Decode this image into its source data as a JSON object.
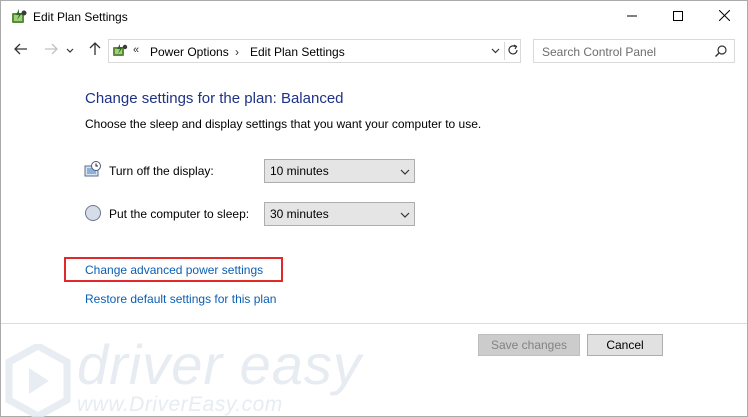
{
  "window": {
    "title": "Edit Plan Settings",
    "app_icon": "power-options-icon",
    "controls": [
      "minimize-icon",
      "maximize-icon",
      "close-icon"
    ]
  },
  "navigation": {
    "back_icon": "arrow-left-icon",
    "forward_icon": "arrow-right-icon",
    "recent_icon": "chevron-down-icon",
    "up_icon": "arrow-up-icon",
    "address": {
      "overflow": "«",
      "breadcrumbs": [
        "Power Options",
        "Edit Plan Settings"
      ],
      "separator": "›"
    },
    "search": {
      "placeholder": "Search Control Panel"
    }
  },
  "main": {
    "heading": "Change settings for the plan: Balanced",
    "description": "Choose the sleep and display settings that you want your computer to use.",
    "settings": [
      {
        "label": "Turn off the display:",
        "value": "10 minutes",
        "icon": "display-clock-icon"
      },
      {
        "label": "Put the computer to sleep:",
        "value": "30 minutes",
        "icon": "moon-sleep-icon"
      }
    ],
    "links": {
      "advanced": "Change advanced power settings",
      "restore": "Restore default settings for this plan"
    }
  },
  "footer": {
    "save_label": "Save changes",
    "cancel_label": "Cancel"
  },
  "watermark": {
    "brand": "driver easy",
    "url": "www.DriverEasy.com"
  },
  "colors": {
    "heading": "#1e3287",
    "link": "#0a5fb4",
    "highlight": "#e0292b"
  }
}
